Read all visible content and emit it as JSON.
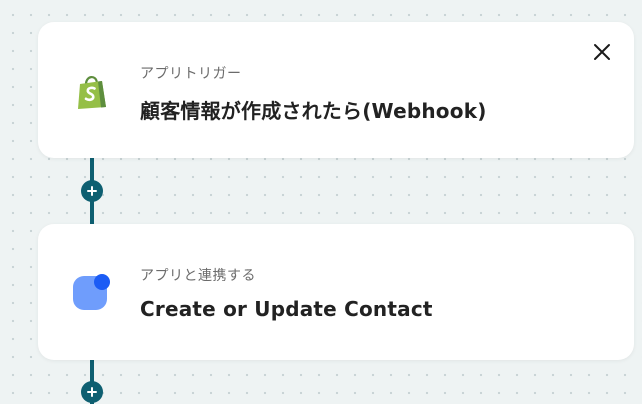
{
  "flow": {
    "steps": [
      {
        "subtitle": "アプリトリガー",
        "title": "顧客情報が作成されたら(Webhook)",
        "icon": "shopify-icon",
        "has_close": true
      },
      {
        "subtitle": "アプリと連携する",
        "title": "Create or Update Contact",
        "icon": "app-connect-icon",
        "has_close": false
      }
    ]
  },
  "colors": {
    "connector": "#0e5f71",
    "card_background": "#ffffff",
    "canvas_background": "#eef3f3",
    "shopify_green": "#95bf47",
    "connect_icon_light": "#6f9dfc",
    "connect_icon_dot": "#1b5cf5"
  }
}
